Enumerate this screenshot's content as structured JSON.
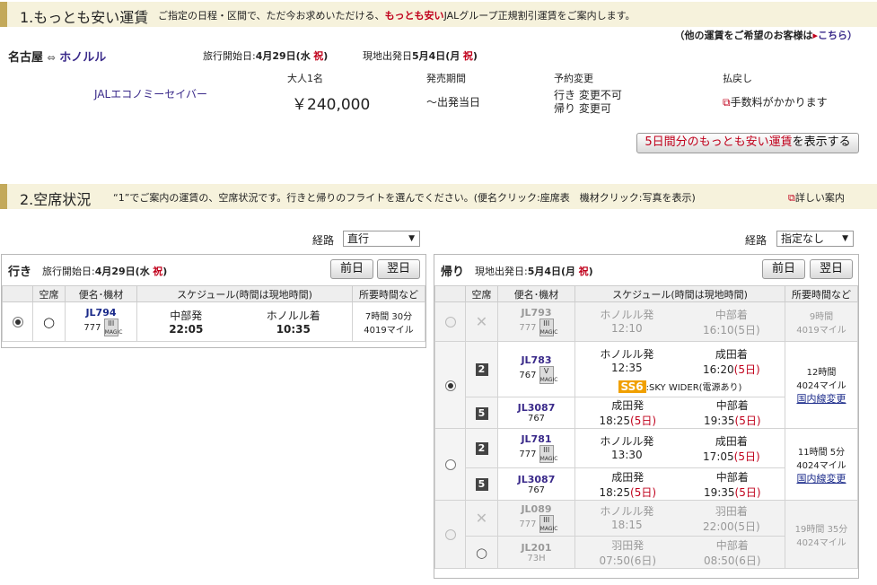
{
  "sec1": {
    "num_title": "1.もっとも安い運賃",
    "desc_pre": "ご指定の日程・区間で、ただ今お求めいただける、",
    "desc_red": "もっとも安い",
    "desc_post": "JALグループ正規割引運賃をご案内します。",
    "other_link": "（他の運賃をご希望のお客様は",
    "other_link2": "こちら）",
    "route_from": "名古屋",
    "route_to": "ホノルル",
    "dep_label": "旅行開始日:",
    "dep_date": "4月29日(水",
    "dep_hol": "祝",
    "dep_close": ")",
    "ret_label": "現地出発日",
    "ret_date": "5月4日(月",
    "ret_hol": "祝",
    "ret_close": ")",
    "fare_name": "JALエコノミーセイバー",
    "col_adult": "大人1名",
    "col_period": "発売期間",
    "col_change": "予約変更",
    "col_refund": "払戻し",
    "price": "￥240,000",
    "period": "～出発当日",
    "change_out": "行き 変更不可",
    "change_ret": "帰り 変更可",
    "refund": "手数料がかかります",
    "btn_5days_red": "5日間分のもっとも安い運賃",
    "btn_5days": "を表示する"
  },
  "sec2": {
    "num_title": "2.空席状況",
    "desc": "“1”でご案内の運賃の、空席状況です。行きと帰りのフライトを選んでください。(便名クリック:座席表　機材クリック:写真を表示)",
    "detail_link": "詳しい案内",
    "route_label": "経路",
    "out_route_value": "直行",
    "ret_route_value": "指定なし"
  },
  "outbound": {
    "title": "行き",
    "date_label": "旅行開始日:",
    "date": "4月29日(水",
    "hol": "祝",
    "close": ")",
    "prev": "前日",
    "next": "翌日",
    "headers": [
      "空席",
      "便名･機材",
      "スケジュール(時間は現地時間)",
      "所要時間など"
    ],
    "flight": "JL794",
    "aircraft": "777",
    "ac_code": "III",
    "ac_sub": "MAGIC",
    "dep_station": "中部発",
    "dep_time": "22:05",
    "arr_station": "ホノルル着",
    "arr_time": "10:35",
    "duration": "7時間 30分",
    "miles": "4019マイル"
  },
  "return": {
    "title": "帰り",
    "date_label": "現地出発日:",
    "date": "5月4日(月",
    "hol": "祝",
    "close": ")",
    "prev": "前日",
    "next": "翌日",
    "headers": [
      "空席",
      "便名･機材",
      "スケジュール(時間は現地時間)",
      "所要時間など"
    ],
    "opt1": {
      "flight": "JL793",
      "aircraft": "777",
      "ac_code": "III",
      "ac_sub": "MAGIC",
      "dep": "ホノルル発",
      "dep_time": "12:10",
      "arr": "中部着",
      "arr_time": "16:10",
      "arr_day": "(5日)",
      "duration": "9時間",
      "miles": "4019マイル"
    },
    "opt2": {
      "seg1_seat": "2",
      "seg1_flight": "JL783",
      "seg1_aircraft": "767",
      "seg1_ac_code": "V",
      "seg1_ac_sub": "MAGIC",
      "seg1_dep": "ホノルル発",
      "seg1_dep_time": "12:35",
      "seg1_arr": "成田着",
      "seg1_arr_time": "16:20",
      "seg1_arr_day": "(5日)",
      "seat_class": "SS6",
      "seat_class_desc": ":SKY WIDER(電源あり)",
      "seg2_seat": "5",
      "seg2_flight": "JL3087",
      "seg2_aircraft": "767",
      "seg2_dep": "成田発",
      "seg2_dep_time": "18:25",
      "seg2_dep_day": "(5日)",
      "seg2_arr": "中部着",
      "seg2_arr_time": "19:35",
      "seg2_arr_day": "(5日)",
      "duration": "12時間",
      "miles": "4024マイル",
      "domestic": "国内線変更"
    },
    "opt3": {
      "seg1_seat": "2",
      "seg1_flight": "JL781",
      "seg1_aircraft": "777",
      "seg1_ac_code": "III",
      "seg1_ac_sub": "MAGIC",
      "seg1_dep": "ホノルル発",
      "seg1_dep_time": "13:30",
      "seg1_arr": "成田着",
      "seg1_arr_time": "17:05",
      "seg1_arr_day": "(5日)",
      "seg2_seat": "5",
      "seg2_flight": "JL3087",
      "seg2_aircraft": "767",
      "seg2_dep": "成田発",
      "seg2_dep_time": "18:25",
      "seg2_dep_day": "(5日)",
      "seg2_arr": "中部着",
      "seg2_arr_time": "19:35",
      "seg2_arr_day": "(5日)",
      "duration": "11時間 5分",
      "miles": "4024マイル",
      "domestic": "国内線変更"
    },
    "opt4": {
      "seg1_flight": "JL089",
      "seg1_aircraft": "777",
      "seg1_ac_code": "III",
      "seg1_ac_sub": "MAGIC",
      "seg1_dep": "ホノルル発",
      "seg1_dep_time": "18:15",
      "seg1_arr": "羽田着",
      "seg1_arr_time": "22:00",
      "seg1_arr_day": "(5日)",
      "seg2_flight": "JL201",
      "seg2_aircraft": "73H",
      "seg2_dep": "羽田発",
      "seg2_dep_time": "07:50",
      "seg2_dep_day": "(6日)",
      "seg2_arr": "中部着",
      "seg2_arr_time": "08:50",
      "seg2_arr_day": "(6日)",
      "duration": "19時間 35分",
      "miles": "4024マイル"
    }
  }
}
